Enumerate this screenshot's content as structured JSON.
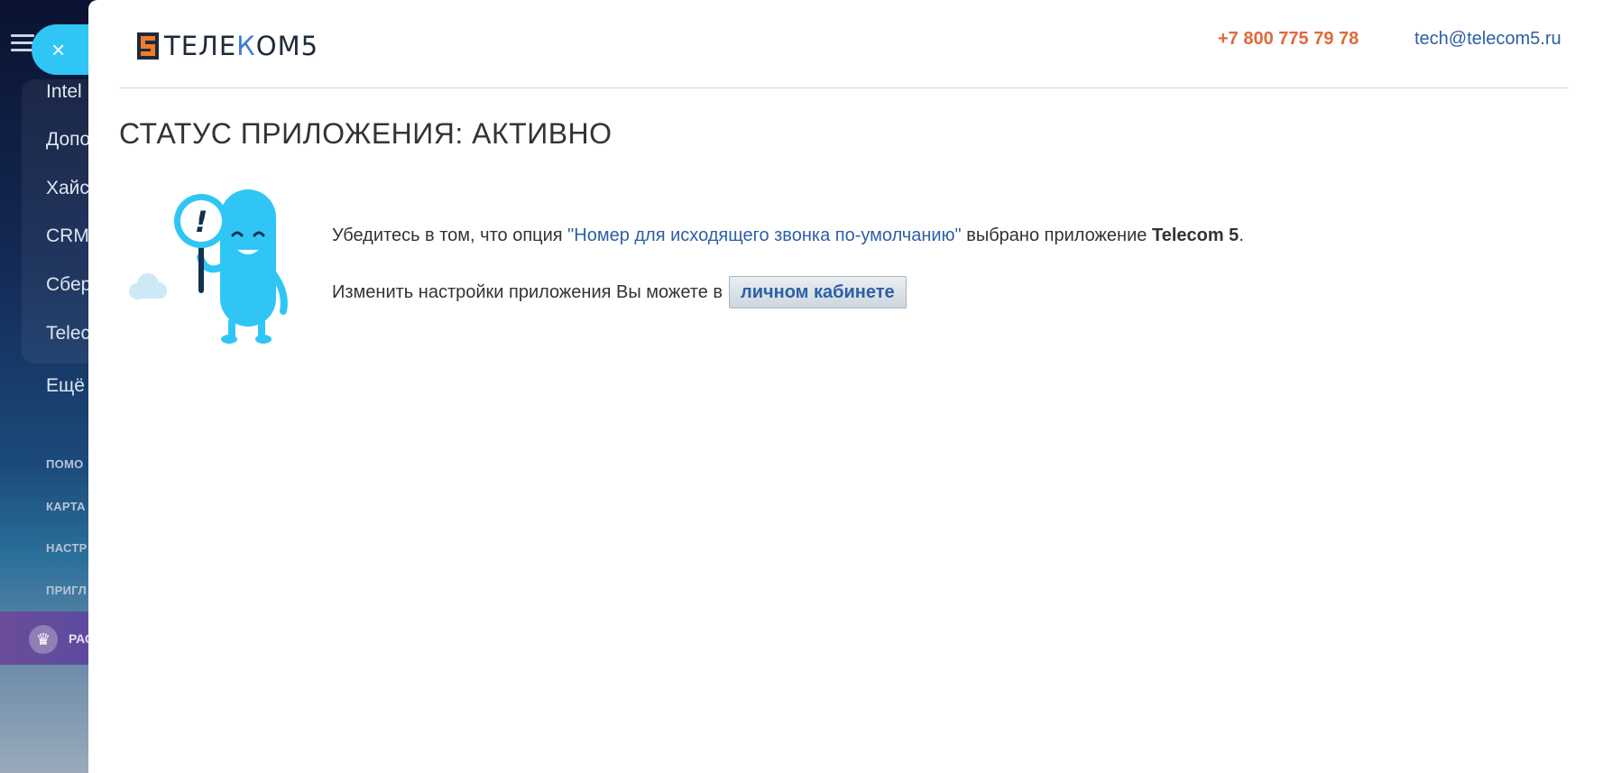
{
  "background_app": {
    "menu_items": [
      "Intel",
      "Допо",
      "Хайс",
      "CRM",
      "Сбер",
      "Telec",
      "Ещё"
    ],
    "footer_links": [
      "ПОМО",
      "КАРТА",
      "НАСТР",
      "ПРИГЛ"
    ],
    "promo_label": "РАС"
  },
  "close_button": {
    "label": "×"
  },
  "header": {
    "logo_text_1": "ТЕЛЕ",
    "logo_text_2": "К",
    "logo_text_3": "ОМ5",
    "phone": "+7 800 775 79 78",
    "email": "tech@telecom5.ru"
  },
  "main": {
    "title": "СТАТУС ПРИЛОЖЕНИЯ: АКТИВНО",
    "line1_prefix": "Убедитесь в том, что опция ",
    "line1_option": "\"Номер для исходящего звонка по-умолчанию\"",
    "line1_middle": " выбрано приложение ",
    "line1_app": "Telecom 5",
    "line1_suffix": ".",
    "line2_text": "Изменить настройки приложения Вы можете в",
    "cabinet_button": "личном кабинете"
  },
  "colors": {
    "accent": "#2fc6f6",
    "phone": "#e06a3a",
    "link": "#2d5fa6"
  },
  "icons": [
    "hamburger-icon",
    "close-icon",
    "crown-icon",
    "telecom5-logo-icon",
    "mascot-illustration"
  ]
}
